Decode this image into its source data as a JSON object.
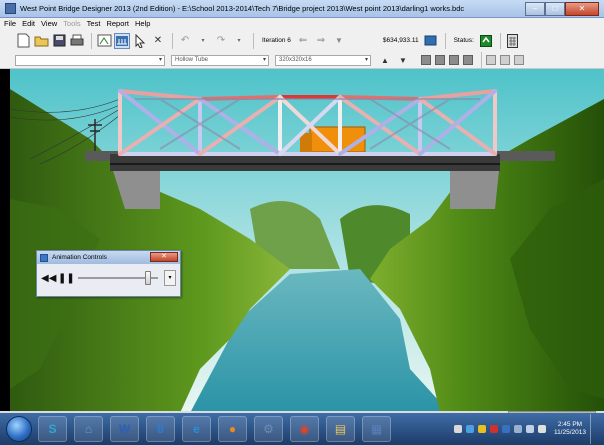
{
  "window": {
    "title": "West Point Bridge Designer 2013 (2nd Edition) - E:\\School 2013-2014\\Tech 7\\Bridge project 2013\\West point 2013\\darling1 works.bdc",
    "controls": {
      "minimize": "–",
      "maximize": "□",
      "close": "✕"
    }
  },
  "menu": [
    {
      "label": "File",
      "enabled": true
    },
    {
      "label": "Edit",
      "enabled": true
    },
    {
      "label": "View",
      "enabled": true
    },
    {
      "label": "Tools",
      "enabled": false
    },
    {
      "label": "Test",
      "enabled": true
    },
    {
      "label": "Report",
      "enabled": true
    },
    {
      "label": "Help",
      "enabled": true
    }
  ],
  "toolbar": {
    "iteration_label": "Iteration 6",
    "cost": "$634,933.11",
    "status_label": "Status:"
  },
  "toolbar2": {
    "material": "",
    "section": "Hollow Tube",
    "size": "320x320x16"
  },
  "animation_controls": {
    "title": "Animation Controls",
    "close_label": "✕",
    "speed_fraction": 0.9,
    "menu_label": "▾"
  },
  "taskbar": {
    "apps": [
      {
        "name": "s-app",
        "glyph": "S",
        "color": "#2ea8d6"
      },
      {
        "name": "explorer-app",
        "glyph": "⌂",
        "color": "#5aa1e0"
      },
      {
        "name": "word-app",
        "glyph": "W",
        "color": "#2b5fb8"
      },
      {
        "name": "g-app",
        "glyph": "8",
        "color": "#2e7bd6"
      },
      {
        "name": "ie-app",
        "glyph": "e",
        "color": "#2a8ce0"
      },
      {
        "name": "media-app",
        "glyph": "●",
        "color": "#e88a1e"
      },
      {
        "name": "settings-app",
        "glyph": "⚙",
        "color": "#6f8bb5"
      },
      {
        "name": "chrome-app",
        "glyph": "◉",
        "color": "#e0442b"
      },
      {
        "name": "folder-app",
        "glyph": "▤",
        "color": "#e8c65a"
      },
      {
        "name": "bridge-app",
        "glyph": "▦",
        "color": "#5b7fb8"
      }
    ],
    "time": "2:45 PM",
    "date": "11/25/2013"
  }
}
